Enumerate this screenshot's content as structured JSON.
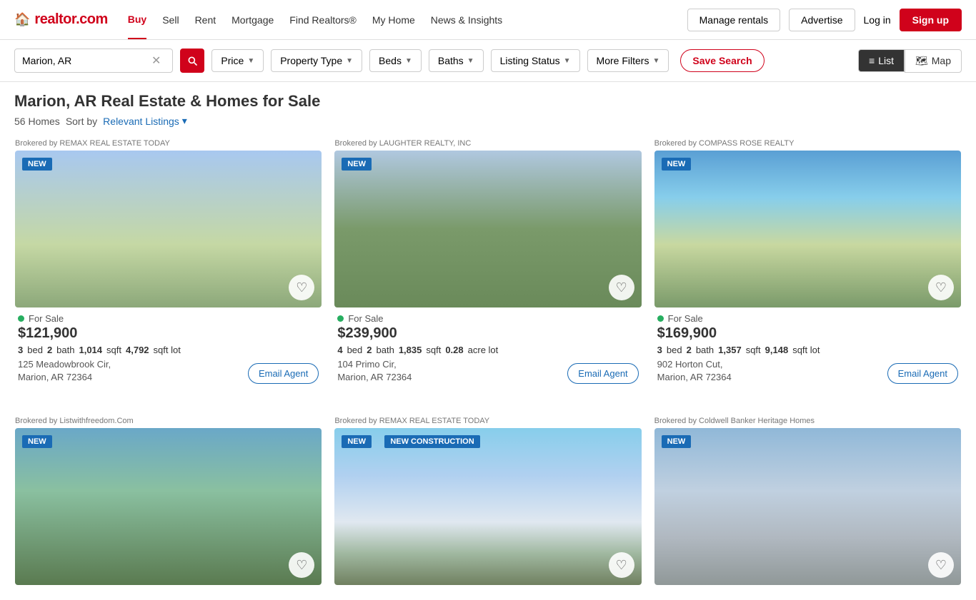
{
  "header": {
    "logo": "realtor.com",
    "nav": [
      {
        "label": "Buy",
        "active": true
      },
      {
        "label": "Sell",
        "active": false
      },
      {
        "label": "Rent",
        "active": false
      },
      {
        "label": "Mortgage",
        "active": false
      },
      {
        "label": "Find Realtors®",
        "active": false
      },
      {
        "label": "My Home",
        "active": false
      },
      {
        "label": "News & Insights",
        "active": false
      }
    ],
    "manage_rentals": "Manage rentals",
    "advertise": "Advertise",
    "login": "Log in",
    "signup": "Sign up"
  },
  "search_bar": {
    "location": "Marion, AR",
    "filters": [
      {
        "label": "Price"
      },
      {
        "label": "Property Type"
      },
      {
        "label": "Beds"
      },
      {
        "label": "Baths"
      },
      {
        "label": "Listing Status"
      },
      {
        "label": "More Filters"
      }
    ],
    "save_search": "Save Search",
    "view_list": "List",
    "view_map": "Map"
  },
  "results": {
    "title": "Marion, AR Real Estate & Homes for Sale",
    "count": "56 Homes",
    "sort_label": "Sort by",
    "sort_value": "Relevant Listings"
  },
  "listings": [
    {
      "brokered_by": "Brokered by REMAX REAL ESTATE TODAY",
      "badge": "NEW",
      "status": "For Sale",
      "price": "$121,900",
      "beds": "3",
      "baths": "2",
      "sqft": "1,014",
      "lot": "4,792",
      "lot_unit": "sqft lot",
      "address_line1": "125 Meadowbrook Cir,",
      "address_line2": "Marion, AR 72364",
      "img_class": "img-house1"
    },
    {
      "brokered_by": "Brokered by LAUGHTER REALTY, INC",
      "badge": "NEW",
      "status": "For Sale",
      "price": "$239,900",
      "beds": "4",
      "baths": "2",
      "sqft": "1,835",
      "lot": "0.28",
      "lot_unit": "acre lot",
      "address_line1": "104 Primo Cir,",
      "address_line2": "Marion, AR 72364",
      "img_class": "img-house2"
    },
    {
      "brokered_by": "Brokered by COMPASS ROSE REALTY",
      "badge": "NEW",
      "status": "For Sale",
      "price": "$169,900",
      "beds": "3",
      "baths": "2",
      "sqft": "1,357",
      "lot": "9,148",
      "lot_unit": "sqft lot",
      "address_line1": "902 Horton Cut,",
      "address_line2": "Marion, AR 72364",
      "img_class": "img-house3"
    },
    {
      "brokered_by": "Brokered by Listwithfreedom.Com",
      "badge": "NEW",
      "status": "",
      "price": "",
      "beds": "",
      "baths": "",
      "sqft": "",
      "lot": "",
      "lot_unit": "",
      "address_line1": "",
      "address_line2": "",
      "img_class": "img-house4"
    },
    {
      "brokered_by": "Brokered by REMAX REAL ESTATE TODAY",
      "badge": "NEW",
      "badge2": "NEW CONSTRUCTION",
      "status": "",
      "price": "",
      "beds": "",
      "baths": "",
      "sqft": "",
      "lot": "",
      "lot_unit": "",
      "address_line1": "",
      "address_line2": "",
      "img_class": "img-house5"
    },
    {
      "brokered_by": "Brokered by Coldwell Banker Heritage Homes",
      "badge": "NEW",
      "status": "",
      "price": "",
      "beds": "",
      "baths": "",
      "sqft": "",
      "lot": "",
      "lot_unit": "",
      "address_line1": "",
      "address_line2": "",
      "img_class": "img-house6"
    }
  ],
  "labels": {
    "bed": "bed",
    "bath": "bath",
    "sqft": "sqft",
    "email_agent": "Email Agent",
    "for_sale": "For Sale"
  }
}
